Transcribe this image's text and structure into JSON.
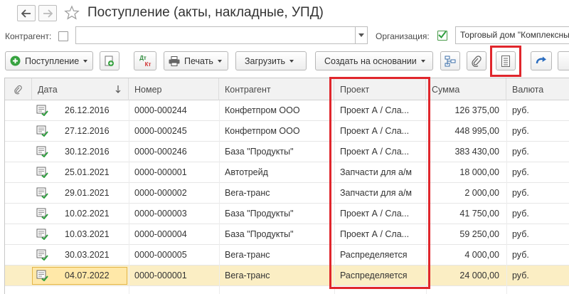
{
  "window": {
    "title": "Поступление (акты, накладные, УПД)"
  },
  "filters": {
    "counterparty_label": "Контрагент:",
    "counterparty_value": "",
    "organization_label": "Организация:",
    "organization_value": "Торговый дом \"Комплексный\""
  },
  "toolbar": {
    "receipt_label": "Поступление",
    "dt_kt_top": "Дт",
    "dt_kt_bottom": "Кт",
    "print_label": "Печать",
    "load_label": "Загрузить",
    "create_based_label": "Создать на основании"
  },
  "table": {
    "columns": [
      "Дата",
      "Номер",
      "Контрагент",
      "Проект",
      "Сумма",
      "Валюта"
    ],
    "rows": [
      [
        "26.12.2016",
        "0000-000244",
        "Конфетпром ООО",
        "Проект А / Сла...",
        "126 375,00",
        "руб."
      ],
      [
        "27.12.2016",
        "0000-000245",
        "Конфетпром ООО",
        "Проект А / Сла...",
        "448 995,00",
        "руб."
      ],
      [
        "30.12.2016",
        "0000-000246",
        "База \"Продукты\"",
        "Проект А / Сла...",
        "383 430,00",
        "руб."
      ],
      [
        "25.01.2021",
        "0000-000001",
        "Автотрейд",
        "Запчасти для а/м",
        "18 000,00",
        "руб."
      ],
      [
        "29.01.2021",
        "0000-000002",
        "Вега-транс",
        "Запчасти для а/м",
        "2 000,00",
        "руб."
      ],
      [
        "10.02.2021",
        "0000-000003",
        "База \"Продукты\"",
        "Проект А / Сла...",
        "41 750,00",
        "руб."
      ],
      [
        "10.03.2021",
        "0000-000004",
        "База \"Продукты\"",
        "Проект А / Сла...",
        "59 250,00",
        "руб."
      ],
      [
        "30.03.2021",
        "0000-000005",
        "Вега-транс",
        "Распределяется",
        "4 000,00",
        "руб."
      ],
      [
        "04.07.2022",
        "0000-000001",
        "Вега-транс",
        "Распределяется",
        "24 000,00",
        "руб."
      ]
    ],
    "selected_row": 8
  },
  "colors": {
    "highlight": "#e0262c",
    "accent_green": "#2e9e3e",
    "selected_row": "#fbeec4"
  },
  "icons": [
    "back-arrow-icon",
    "forward-arrow-icon",
    "favorite-star-icon",
    "add-circle-icon",
    "copy-document-icon",
    "printer-icon",
    "structure-icon",
    "attachment-icon",
    "list-settings-icon",
    "refresh-icon",
    "document-posted-icon"
  ]
}
